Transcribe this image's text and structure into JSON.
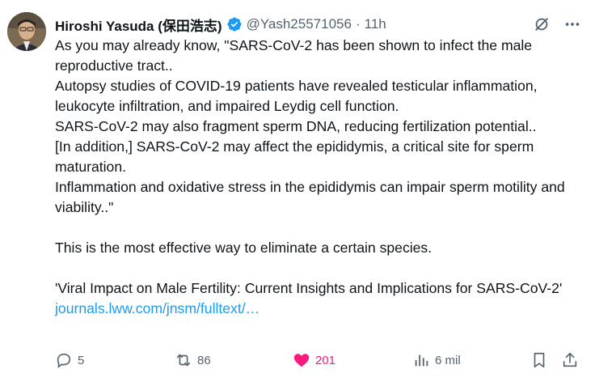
{
  "tweet": {
    "author": {
      "display_name": "Hiroshi Yasuda (保田浩志)",
      "handle": "@Yash25571056",
      "verified": true
    },
    "separator": "·",
    "time": "11h",
    "text_lines": [
      "As you may already know, \"SARS-CoV-2 has been shown to infect the male reproductive tract..",
      "Autopsy studies of COVID-19 patients have revealed testicular inflammation, leukocyte infiltration, and impaired Leydig cell function.",
      "SARS-CoV-2 may also fragment sperm DNA, reducing fertilization potential..",
      "[In addition,] SARS-CoV-2 may affect the epididymis, a critical site for sperm maturation.",
      "Inflammation and oxidative stress in the epididymis can impair sperm motility and viability..\"",
      "",
      "This is the most effective way to eliminate a certain species.",
      "",
      "'Viral Impact on Male Fertility: Current Insights and Implications for SARS-CoV-2'"
    ],
    "link_text": "journals.lww.com/jnsm/fulltext/…",
    "stats": {
      "replies": "5",
      "reposts": "86",
      "likes": "201",
      "views": "6 mil"
    }
  },
  "colors": {
    "accent": "#1d9bf0",
    "like": "#f91880",
    "muted": "#536471",
    "text": "#0f1419"
  },
  "icons": {
    "verified": "verified-badge-icon",
    "grok": "grok-icon",
    "more": "more-icon",
    "reply": "reply-icon",
    "repost": "repost-icon",
    "like": "heart-icon",
    "views": "views-icon",
    "bookmark": "bookmark-icon",
    "share": "share-icon"
  }
}
